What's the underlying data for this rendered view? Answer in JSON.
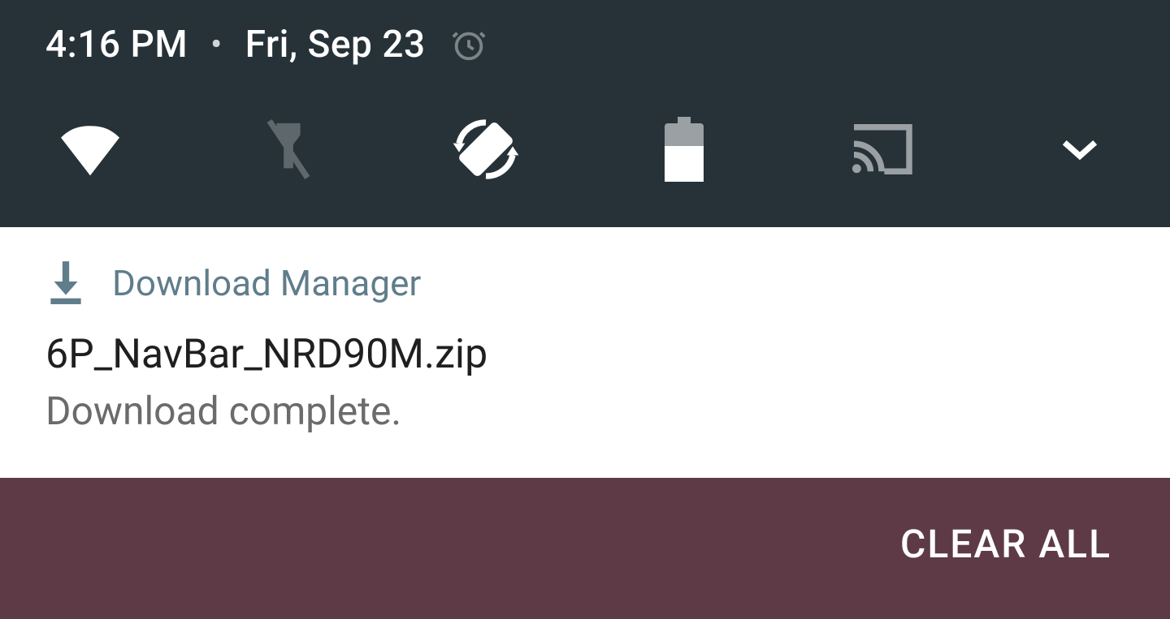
{
  "status": {
    "time": "4:16 PM",
    "date": "Fri, Sep 23"
  },
  "quick_toggles": {
    "wifi": "wifi",
    "flashlight": "flashlight-off",
    "autorotate": "auto-rotate",
    "battery": "battery",
    "cast": "cast",
    "expand": "chevron-down"
  },
  "notification": {
    "app": "Download Manager",
    "title": "6P_NavBar_NRD90M.zip",
    "subtitle": "Download complete."
  },
  "footer": {
    "clear_all": "CLEAR ALL"
  }
}
